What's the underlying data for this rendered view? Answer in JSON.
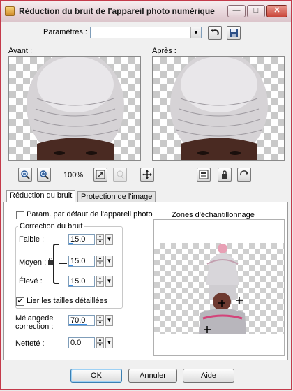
{
  "window": {
    "title": "Réduction du bruit de l'appareil photo numérique",
    "min_glyph": "—",
    "max_glyph": "□",
    "close_glyph": "✕"
  },
  "params": {
    "label": "Paramètres :",
    "value": ""
  },
  "preview": {
    "before_label": "Avant :",
    "after_label": "Après :",
    "zoom": "100%"
  },
  "tabs": [
    {
      "label": "Réduction du bruit"
    },
    {
      "label": "Protection de l'image"
    }
  ],
  "options": {
    "default_camera_label": "Param. par défaut de l'appareil photo",
    "default_camera_checked": false,
    "group_title": "Correction du bruit",
    "faible_label": "Faible :",
    "faible_value": "15.0",
    "moyen_label": "Moyen :",
    "moyen_value": "15.0",
    "eleve_label": "Élevé :",
    "eleve_value": "15.0",
    "link_label": "Lier les tailles détaillées",
    "link_checked": true,
    "blend_label_1": "Mélangede",
    "blend_label_2": "correction :",
    "blend_value": "70.0",
    "sharp_label": "Netteté :",
    "sharp_value": "0.0"
  },
  "zones": {
    "title": "Zones d'échantillonnage"
  },
  "buttons": {
    "ok": "OK",
    "cancel": "Annuler",
    "help": "Aide"
  },
  "colors": {
    "accent": "#3a8ee6",
    "frame": "#c43a4a"
  }
}
